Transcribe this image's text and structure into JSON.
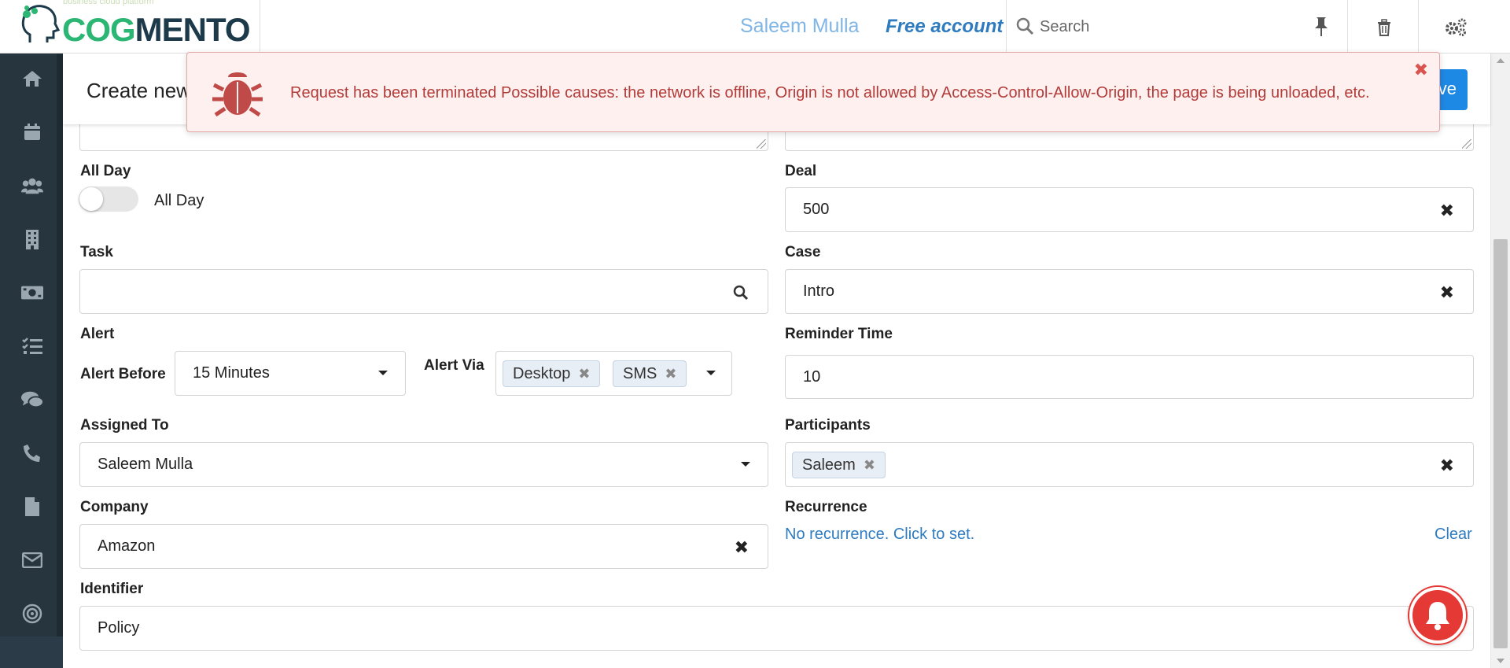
{
  "header": {
    "logo_text_1": "COG",
    "logo_text_2": "MENTO",
    "logo_tagline": "business cloud platform",
    "user_name": "Saleem Mulla",
    "account_type": "Free account",
    "search_placeholder": "Search"
  },
  "sidebar": {
    "items": [
      "home-icon",
      "calendar-icon",
      "contacts-icon",
      "companies-icon",
      "deals-icon",
      "tasks-icon",
      "cases-icon",
      "calls-icon",
      "documents-icon",
      "email-icon",
      "campaigns-icon"
    ]
  },
  "page": {
    "title": "Create new Event",
    "save_label": "Save"
  },
  "error_toast": {
    "message": "Request has been terminated Possible causes: the network is offline, Origin is not allowed by Access-Control-Allow-Origin, the page is being unloaded, etc."
  },
  "form": {
    "all_day": {
      "label": "All Day",
      "toggle_text": "All Day",
      "value": false
    },
    "deal": {
      "label": "Deal",
      "value": "500"
    },
    "task": {
      "label": "Task",
      "value": ""
    },
    "case": {
      "label": "Case",
      "value": "Intro"
    },
    "alert": {
      "label": "Alert",
      "before_label": "Alert Before",
      "before_value": "15 Minutes",
      "via_label": "Alert Via",
      "via_chips": [
        "Desktop",
        "SMS"
      ]
    },
    "reminder_time": {
      "label": "Reminder Time",
      "value": "10"
    },
    "assigned_to": {
      "label": "Assigned To",
      "value": "Saleem Mulla"
    },
    "participants": {
      "label": "Participants",
      "chips": [
        "Saleem"
      ]
    },
    "company": {
      "label": "Company",
      "value": "Amazon"
    },
    "recurrence": {
      "label": "Recurrence",
      "link_text": "No recurrence. Click to set.",
      "clear_text": "Clear"
    },
    "identifier": {
      "label": "Identifier",
      "value": "Policy"
    }
  },
  "colors": {
    "brand_green": "#2bb673",
    "brand_navy": "#1d3a4a",
    "sidebar_bg": "#27353f",
    "primary_blue": "#1e88e5",
    "error_text": "#b23c3a",
    "error_bg": "#fdf0ef",
    "link_blue": "#2e7bbf",
    "bell_red": "#e53935"
  }
}
